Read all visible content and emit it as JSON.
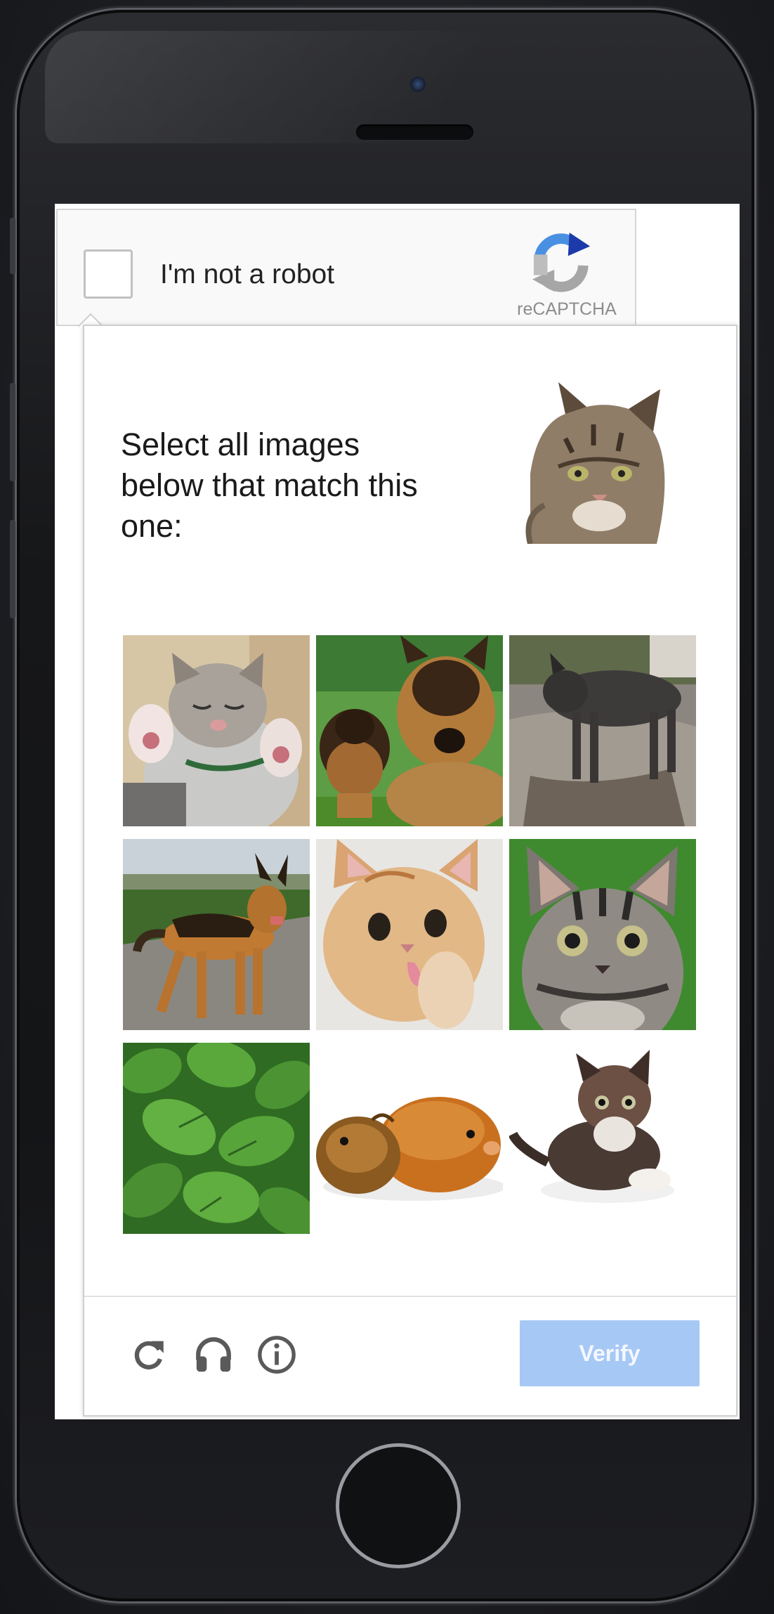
{
  "device": {
    "type": "smartphone"
  },
  "checkbox": {
    "label": "I'm not a robot",
    "checked": false,
    "brand": "reCAPTCHA",
    "logo_icon": "recaptcha-logo-icon"
  },
  "challenge": {
    "instruction": "Select all images below that match this one:",
    "target_image": "tabby-cat-head",
    "tiles": [
      {
        "content": "kitten-lying-paws-up",
        "selected": false
      },
      {
        "content": "german-shepherd-with-puppy",
        "selected": false
      },
      {
        "content": "dark-stray-dog",
        "selected": false
      },
      {
        "content": "german-shepherd-standing",
        "selected": false
      },
      {
        "content": "ginger-kitten-licking-paw",
        "selected": false
      },
      {
        "content": "tabby-kitten-green-background",
        "selected": false
      },
      {
        "content": "green-leaves",
        "selected": false
      },
      {
        "content": "two-guinea-pigs",
        "selected": false
      },
      {
        "content": "fluffy-kitten-sitting",
        "selected": false
      }
    ]
  },
  "footer": {
    "reload_icon": "reload-icon",
    "audio_icon": "headphones-icon",
    "info_icon": "info-icon",
    "verify_label": "Verify"
  },
  "colors": {
    "verify_bg": "#a6c8f5",
    "recaptcha_blue": "#1c3aa9",
    "recaptcha_light_blue": "#4a90e2",
    "recaptcha_gray": "#a6a6a6"
  }
}
